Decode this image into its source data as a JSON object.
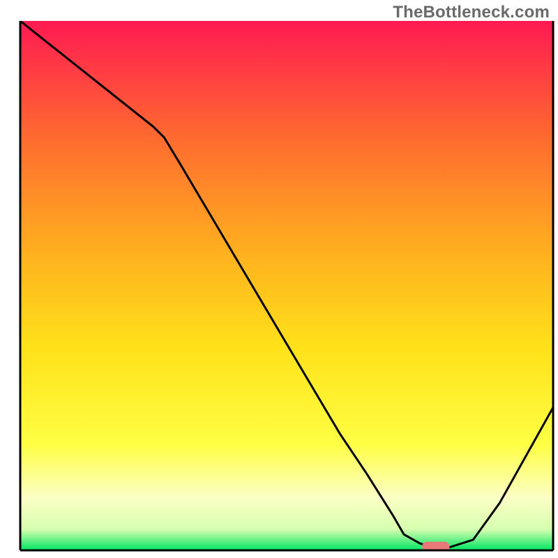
{
  "watermark": "TheBottleneck.com",
  "colors": {
    "gradient_top": "#ff1a52",
    "gradient_mid_upper": "#ff7a2e",
    "gradient_mid": "#ffd31a",
    "gradient_mid_lower": "#ffff44",
    "gradient_lower_yellow": "#fbffb0",
    "gradient_bottom": "#00e561",
    "curve": "#000000",
    "target_fill": "#e77a79",
    "target_stroke": "#e77a79",
    "axis": "#000000"
  },
  "chart_data": {
    "type": "line",
    "title": "",
    "xlabel": "",
    "ylabel": "",
    "xlim": [
      0,
      100
    ],
    "ylim": [
      0,
      100
    ],
    "x": [
      0,
      5,
      10,
      15,
      20,
      25,
      27,
      30,
      35,
      40,
      45,
      50,
      55,
      60,
      65,
      70,
      72,
      75,
      78,
      80,
      85,
      90,
      95,
      100
    ],
    "values": [
      100,
      96,
      92,
      88,
      84,
      80,
      78,
      73,
      64.5,
      56,
      47.5,
      39,
      30.5,
      22,
      14.5,
      6.5,
      3,
      1.3,
      0.4,
      0.4,
      2,
      9,
      18,
      27
    ],
    "target_marker": {
      "x_range": [
        75.5,
        80.5
      ],
      "y": 0.7
    },
    "annotations": []
  }
}
